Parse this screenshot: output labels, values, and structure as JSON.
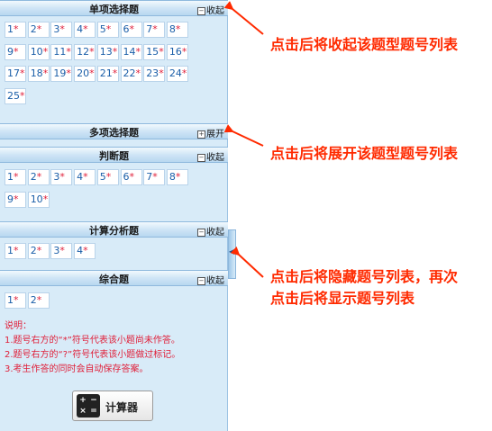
{
  "sections": [
    {
      "title": "单项选择题",
      "toggle_symbol": "⊟",
      "toggle_label": "收起",
      "questions": [
        "1",
        "2",
        "3",
        "4",
        "5",
        "6",
        "7",
        "8",
        "9",
        "10",
        "11",
        "12",
        "13",
        "14",
        "15",
        "16",
        "17",
        "18",
        "19",
        "20",
        "21",
        "22",
        "23",
        "24",
        "25"
      ]
    },
    {
      "title": "多项选择题",
      "toggle_symbol": "⊞",
      "toggle_label": "展开",
      "questions": []
    },
    {
      "title": "判断题",
      "toggle_symbol": "⊟",
      "toggle_label": "收起",
      "questions": [
        "1",
        "2",
        "3",
        "4",
        "5",
        "6",
        "7",
        "8",
        "9",
        "10"
      ]
    },
    {
      "title": "计算分析题",
      "toggle_symbol": "⊟",
      "toggle_label": "收起",
      "questions": [
        "1",
        "2",
        "3",
        "4"
      ]
    },
    {
      "title": "综合题",
      "toggle_symbol": "⊟",
      "toggle_label": "收起",
      "questions": [
        "1",
        "2"
      ]
    }
  ],
  "unanswered_mark": "*",
  "notes": {
    "heading": "说明：",
    "lines": [
      "1.题号右方的“*”符号代表该小题尚未作答。",
      "2.题号右方的“?”符号代表该小题做过标记。",
      "3.考生作答的同时会自动保存答案。"
    ]
  },
  "calculator": {
    "label": "计算器",
    "icon": "calculator-icon"
  },
  "collapse_tab": {
    "glyph": "◀"
  },
  "annotations": [
    "点击后将收起该题型题号列表",
    "点击后将展开该题型题号列表",
    "点击后将隐藏题号列表，再次",
    "点击后将显示题号列表"
  ],
  "colors": {
    "panel_bg": "#d8ebf8",
    "question_number": "#1a5ea8",
    "unanswered_mark": "#e0203a",
    "annotation": "#ff2a00"
  }
}
